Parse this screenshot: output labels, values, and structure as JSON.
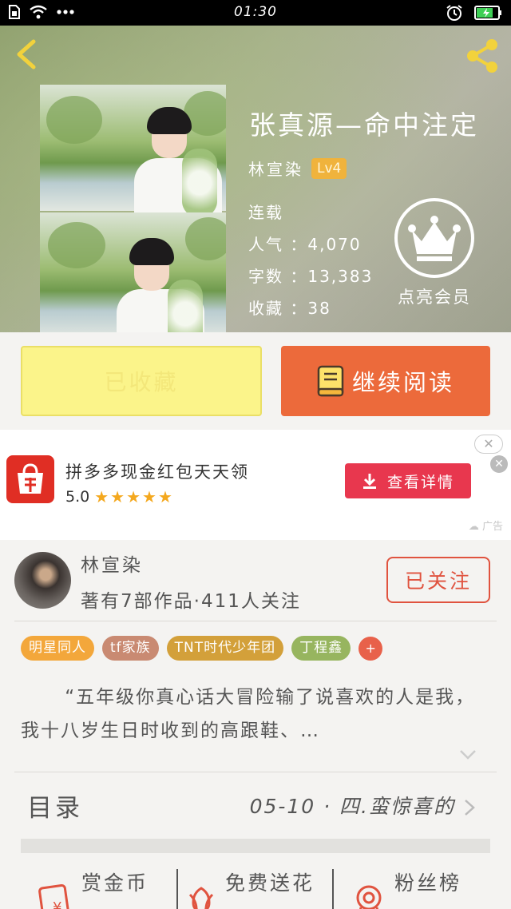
{
  "status_bar": {
    "time": "01:30"
  },
  "book": {
    "title": "张真源—命中注定",
    "author": "林宣染",
    "level": "Lv4",
    "status": "连载",
    "popularity": "人气 ：4,070",
    "word_count": "字数 ：13,383",
    "favorites": "收藏 ：38"
  },
  "vip": {
    "label": "点亮会员"
  },
  "actions": {
    "collected_label": "已收藏",
    "continue_label": "继续阅读"
  },
  "ad": {
    "title": "拼多多现金红包天天领",
    "rating": "5.0",
    "stars": "★★★★★",
    "button_label": "查看详情",
    "tag": "广告",
    "close_top": "✕",
    "close_x": "✕",
    "colors": {
      "brand": "#e02e24",
      "button": "#e8374e"
    }
  },
  "author_section": {
    "name": "林宣染",
    "works_info": "著有7部作品·411人关注",
    "follow_label": "已关注"
  },
  "tags": [
    {
      "label": "明星同人",
      "color": "#f3a73b"
    },
    {
      "label": "tf家族",
      "color": "#c98a72"
    },
    {
      "label": "TNT时代少年团",
      "color": "#d3a03a"
    },
    {
      "label": "丁程鑫",
      "color": "#97b55f"
    }
  ],
  "tags_more": "+",
  "synopsis": "“五年级你真心话大冒险输了说喜欢的人是我，我十八岁生日时收到的高跟鞋、…",
  "toc": {
    "label": "目录",
    "latest": "05-10 · 四.蛮惊喜的"
  },
  "bottom_actions": [
    {
      "label": "赏金币",
      "icon": "gold-coin-icon"
    },
    {
      "label": "免费送花",
      "icon": "flower-icon"
    },
    {
      "label": "粉丝榜",
      "icon": "medal-icon"
    }
  ],
  "icons": {
    "back": "back-arrow-icon",
    "share": "share-icon",
    "vip": "crown-icon",
    "book": "book-icon",
    "download": "download-icon",
    "chevron_down": "chevron-down-icon",
    "chevron_right": "chevron-right-icon"
  }
}
